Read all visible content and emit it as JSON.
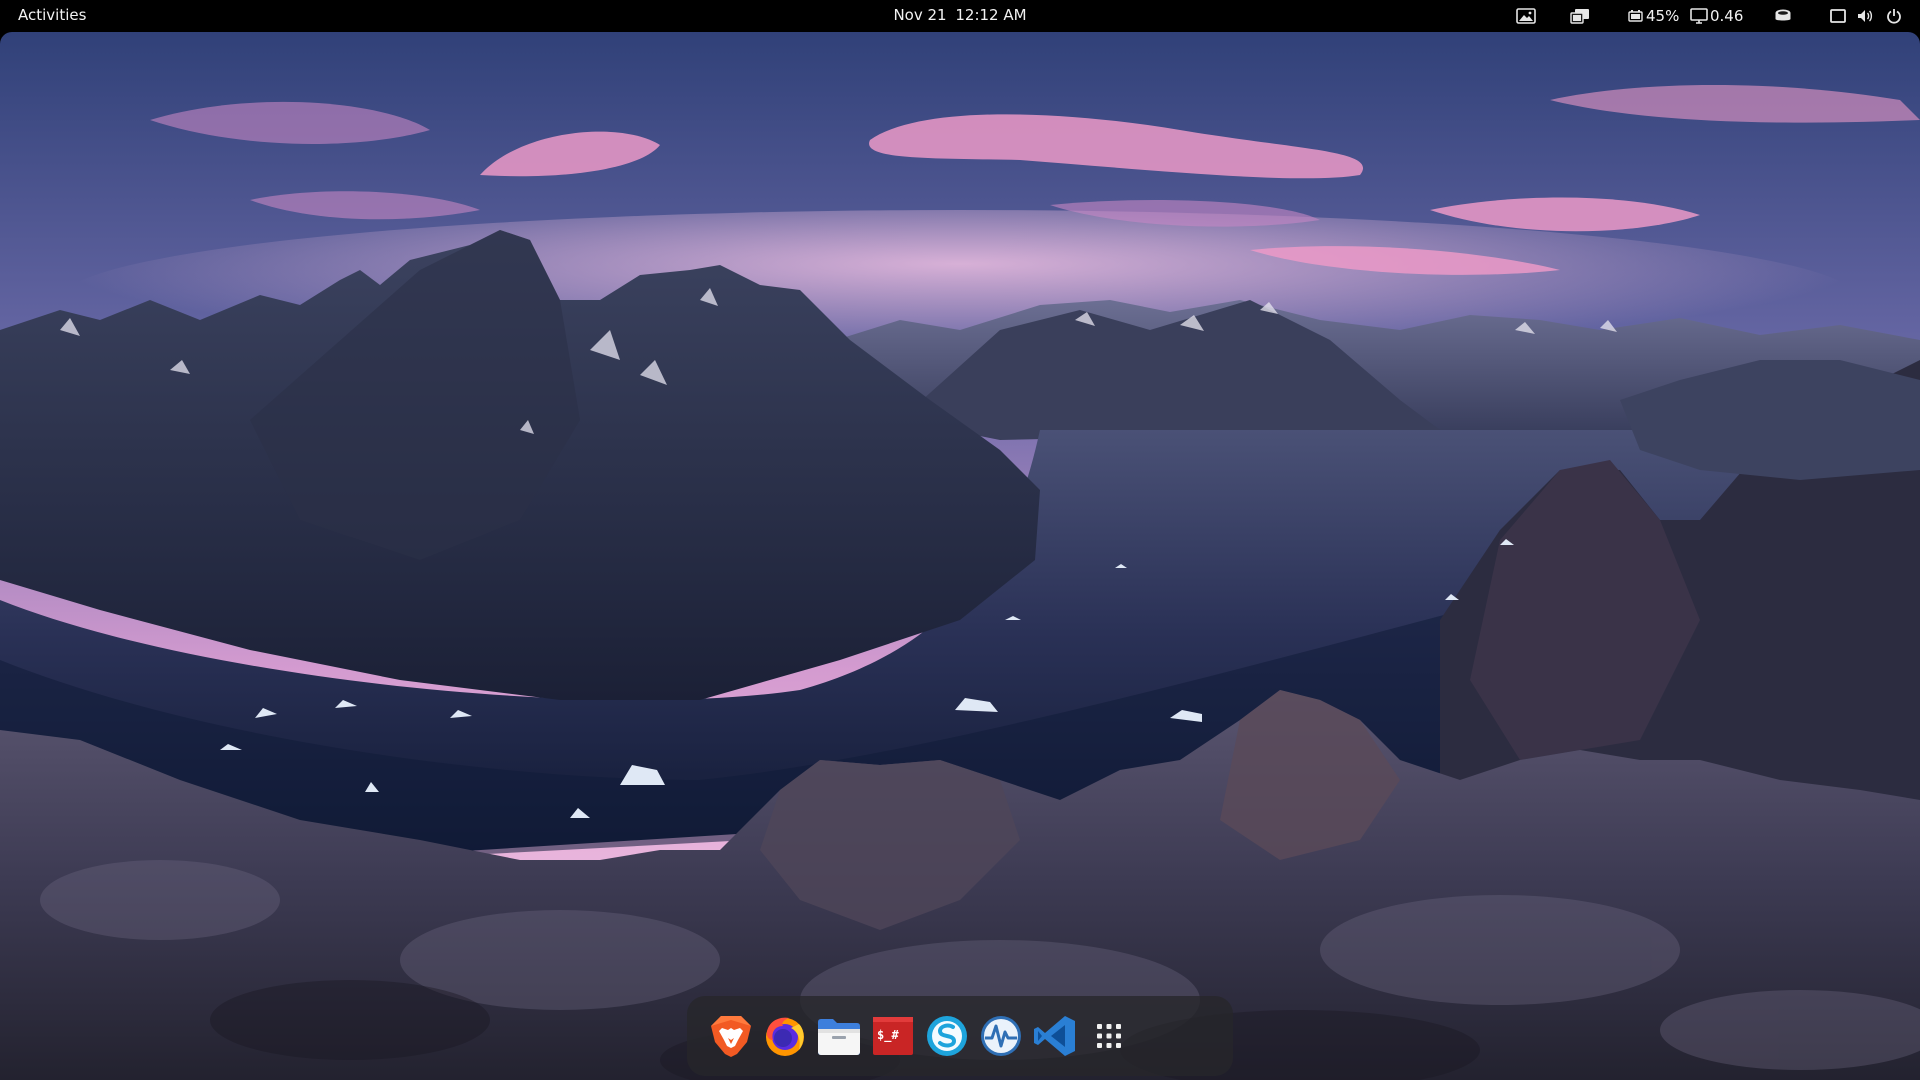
{
  "topbar": {
    "activities_label": "Activities",
    "clock": {
      "date": "Nov 21",
      "time": "12:12 AM"
    },
    "tray": {
      "battery_percent": "45%",
      "load_value": "0.46",
      "icons": [
        "image-viewer-icon",
        "cast-icon",
        "battery-icon",
        "monitor-load-icon",
        "drive-icon",
        "window-icon",
        "volume-icon",
        "power-icon"
      ]
    }
  },
  "dock": {
    "apps": [
      {
        "name": "Brave Browser",
        "icon": "brave-lion-icon"
      },
      {
        "name": "Firefox",
        "icon": "firefox-icon"
      },
      {
        "name": "Files",
        "icon": "folder-icon"
      },
      {
        "name": "Terminal",
        "icon": "terminal-icon",
        "glyph": "$_#"
      },
      {
        "name": "Skype",
        "icon": "skype-icon"
      },
      {
        "name": "System Monitor",
        "icon": "system-monitor-icon"
      },
      {
        "name": "Visual Studio Code",
        "icon": "vscode-icon"
      },
      {
        "name": "Show Applications",
        "icon": "app-grid-icon"
      }
    ]
  },
  "colors": {
    "topbar": "#000000",
    "dock": "#26262a",
    "brave": "#f25a23",
    "terminal": "#c92525",
    "skype": "#1ea4dc",
    "vscode": "#2a7fd4",
    "folder": "#3d7fdc"
  }
}
